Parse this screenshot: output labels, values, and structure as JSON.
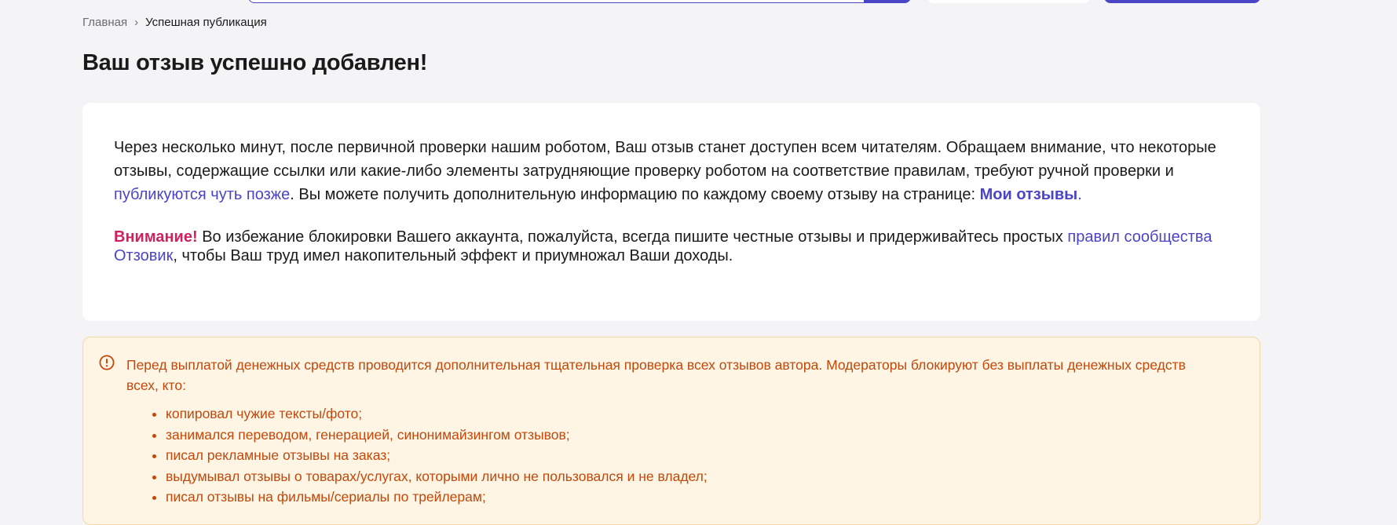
{
  "breadcrumb": {
    "home": "Главная",
    "separator": "›",
    "current": "Успешная публикация"
  },
  "page": {
    "title": "Ваш отзыв успешно добавлен!"
  },
  "info": {
    "p1_part1": "Через несколько минут, после первичной проверки нашим роботом, Ваш отзыв станет доступен всем читателям. Обращаем внимание, что некоторые отзывы, содержащие ссылки или какие-либо элементы затрудняющие проверку роботом на соответствие правилам, требуют ручной проверки и ",
    "p1_link": "публикуются чуть позже",
    "p1_part2": ". Вы можете получить дополнительную информацию по каждому своему отзыву на странице: ",
    "my_reviews_link": "Мои отзывы",
    "p1_end": ".",
    "warning_label": "Внимание!",
    "p2_part1": " Во избежание блокировки Вашего аккаунта, пожалуйста, всегда пишите честные отзывы и придерживайтесь простых ",
    "p2_link": "правил сообщества Отзовик",
    "p2_part2": ", чтобы Ваш труд имел накопительный эффект и приумножал Ваши доходы."
  },
  "alert": {
    "icon": "exclamation-circle-icon",
    "text": "Перед выплатой денежных средств проводится дополнительная тщательная проверка всех отзывов автора. Модераторы блокируют без выплаты денежных средств всех, кто:",
    "items": [
      "копировал чужие тексты/фото;",
      "занимался переводом, генерацией, синонимайзингом отзывов;",
      "писал рекламные отзывы на заказ;",
      "выдумывал отзывы о товарах/услугах, которыми лично не пользовался и не владел;",
      "писал отзывы на фильмы/сериалы по трейлерам;"
    ]
  },
  "colors": {
    "accent": "#4a44c6",
    "warning": "#d0215e",
    "alert_text": "#c2480b",
    "alert_bg": "#fff5e4",
    "page_bg": "#f4f4f6"
  }
}
